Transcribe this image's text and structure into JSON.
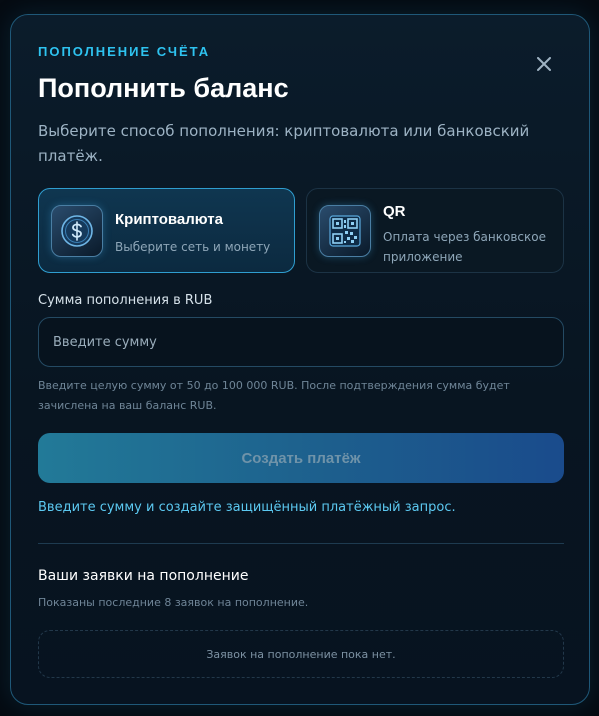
{
  "header": {
    "eyebrow": "ПОПОЛНЕНИЕ СЧЁТА",
    "title": "Пополнить баланс",
    "subtitle": "Выберите способ пополнения: криптовалюта или банковский платёж.",
    "close_icon": "close-icon"
  },
  "methods": [
    {
      "icon": "dollar-coin-icon",
      "title": "Криптовалюта",
      "description": "Выберите сеть и монету",
      "selected": true
    },
    {
      "icon": "qr-code-icon",
      "title": "QR",
      "description": "Оплата через банковское приложение",
      "selected": false
    }
  ],
  "amount": {
    "label": "Сумма пополнения в RUB",
    "placeholder": "Введите сумму",
    "value": "",
    "hint": "Введите целую сумму от 50 до 100 000 RUB. После подтверждения сумма будет зачислена на ваш баланс RUB."
  },
  "submit": {
    "label": "Создать платёж",
    "disabled": true
  },
  "status_text": "Введите сумму и создайте защищённый платёжный запрос.",
  "requests": {
    "title": "Ваши заявки на пополнение",
    "subtitle": "Показаны последние 8 заявок на пополнение.",
    "empty_text": "Заявок на пополнение пока нет."
  },
  "colors": {
    "accent": "#2ec3f0",
    "link": "#5cc9f1",
    "background": "#050b12",
    "panel": "#0b1c2b"
  }
}
